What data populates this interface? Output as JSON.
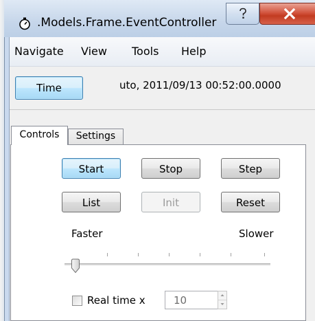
{
  "window": {
    "title": ".Models.Frame.EventController",
    "help_glyph": "?",
    "close_glyph": "X"
  },
  "menu": {
    "items": [
      "Navigate",
      "View",
      "Tools",
      "Help"
    ]
  },
  "toolbar": {
    "time_button": "Time",
    "time_display": "uto, 2011/09/13 00:52:00.0000"
  },
  "tabs": [
    {
      "label": "Controls",
      "active": true
    },
    {
      "label": "Settings",
      "active": false
    }
  ],
  "controls": {
    "buttons_row1": [
      "Start",
      "Stop",
      "Step"
    ],
    "buttons_row2": [
      "List",
      "Init",
      "Reset"
    ],
    "disabled": [
      "Init"
    ],
    "focused": [
      "Start"
    ],
    "slider": {
      "min_label": "Faster",
      "max_label": "Slower",
      "value_fraction": 0.0
    },
    "realtime": {
      "label": "Real time x",
      "checked": false,
      "value": "10"
    }
  },
  "colors": {
    "focus_blue": "#3c7fb1",
    "close_red": "#c23b21",
    "frame_blue": "#c9d9ee"
  }
}
